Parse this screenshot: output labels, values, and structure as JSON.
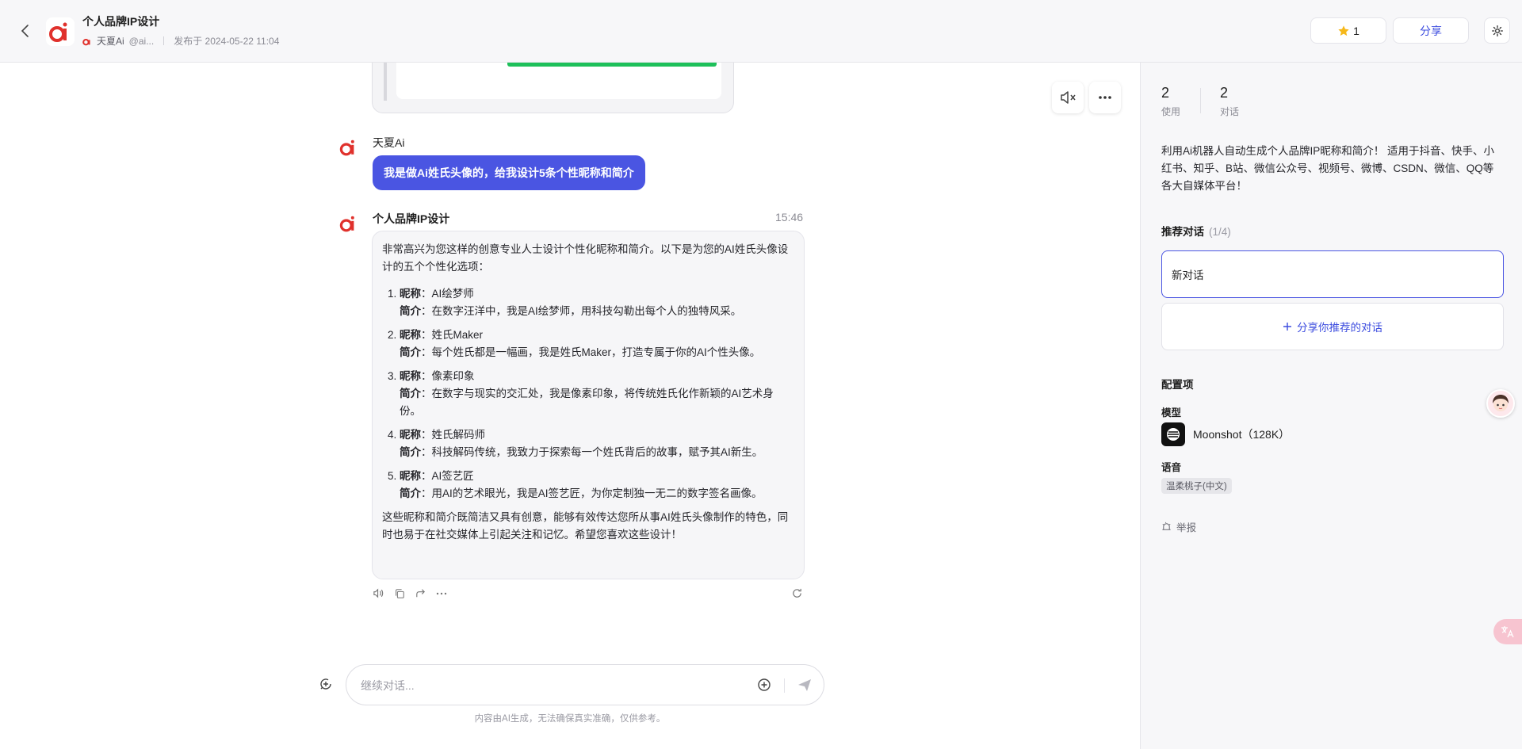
{
  "header": {
    "title": "个人品牌IP设计",
    "author": "天夏Ai",
    "handle": "@ai...",
    "published": "发布于 2024-05-22 11:04",
    "star_count": "1",
    "share_label": "分享"
  },
  "chat": {
    "user_sender": "天夏Ai",
    "user_message": "我是做Ai姓氏头像的，给我设计5条个性昵称和简介",
    "bot_sender": "个人品牌IP设计",
    "bot_time": "15:46",
    "reply": {
      "intro": "非常高兴为您这样的创意专业人士设计个性化昵称和简介。以下是为您的AI姓氏头像设计的五个个性化选项：",
      "nick_label": "昵称",
      "bio_label": "简介",
      "items": [
        {
          "nick": "AI绘梦师",
          "bio": "在数字汪洋中，我是AI绘梦师，用科技勾勒出每个人的独特风采。"
        },
        {
          "nick": "姓氏Maker",
          "bio": "每个姓氏都是一幅画，我是姓氏Maker，打造专属于你的AI个性头像。"
        },
        {
          "nick": "像素印象",
          "bio": "在数字与现实的交汇处，我是像素印象，将传统姓氏化作新颖的AI艺术身份。"
        },
        {
          "nick": "姓氏解码师",
          "bio": "科技解码传统，我致力于探索每一个姓氏背后的故事，赋予其AI新生。"
        },
        {
          "nick": "AI签艺匠",
          "bio": "用AI的艺术眼光，我是AI签艺匠，为你定制独一无二的数字签名画像。"
        }
      ],
      "outro": "这些昵称和简介既简洁又具有创意，能够有效传达您所从事AI姓氏头像制作的特色，同时也易于在社交媒体上引起关注和记忆。希望您喜欢这些设计！"
    }
  },
  "composer": {
    "placeholder": "继续对话...",
    "disclaimer": "内容由AI生成，无法确保真实准确，仅供参考。"
  },
  "panel": {
    "uses_count": "2",
    "uses_label": "使用",
    "dialogs_count": "2",
    "dialogs_label": "对话",
    "description": "利用Ai机器人自动生成个人品牌IP昵称和简介！ 适用于抖音、快手、小红书、知乎、B站、微信公众号、视频号、微博、CSDN、微信、QQ等各大自媒体平台！",
    "recommend_title": "推荐对话",
    "recommend_page": "(1/4)",
    "new_dialog": "新对话",
    "share_recommend": "分享你推荐的对话",
    "config_title": "配置项",
    "model_label": "模型",
    "model_name": "Moonshot（128K）",
    "voice_label": "语音",
    "voice_value": "温柔桃子(中文)",
    "report_label": "举报"
  },
  "colors": {
    "accent": "#4a55e2",
    "brand_red": "#e0312c",
    "progress_green": "#1ec05a"
  }
}
